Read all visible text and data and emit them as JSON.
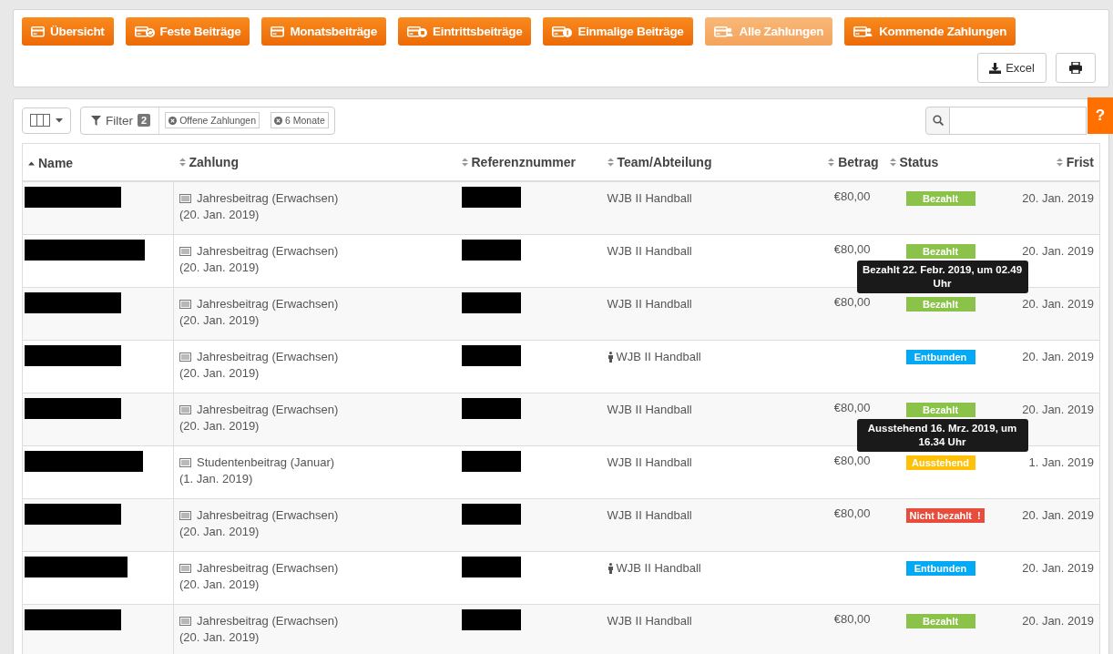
{
  "nav_tabs": [
    {
      "label": "Übersicht",
      "selected": false
    },
    {
      "label": "Feste Beiträge",
      "selected": false
    },
    {
      "label": "Monatsbeiträge",
      "selected": false
    },
    {
      "label": "Eintrittsbeiträge",
      "selected": false
    },
    {
      "label": "Einmalige Beiträge",
      "selected": false
    },
    {
      "label": "Alle Zahlungen",
      "selected": true
    },
    {
      "label": "Kommende Zahlungen",
      "selected": false
    }
  ],
  "export": {
    "excel_label": "Excel"
  },
  "help": {
    "label": "?"
  },
  "filter": {
    "label": "Filter",
    "count": "2",
    "chips": [
      "Offene Zahlungen",
      "6 Monate"
    ]
  },
  "table": {
    "columns": [
      {
        "label": "Name"
      },
      {
        "label": "Zahlung"
      },
      {
        "label": "Referenznummer"
      },
      {
        "label": "Team/Abteilung"
      },
      {
        "label": "Betrag"
      },
      {
        "label": "Status"
      },
      {
        "label": "Frist"
      }
    ],
    "rows": [
      {
        "payment": "Jahresbeitrag (Erwachsen)",
        "payment_date": "(20. Jan. 2019)",
        "team": "WJB II Handball",
        "team_person": false,
        "amount": "€80,00",
        "status": {
          "kind": "paid",
          "label": "Bezahlt"
        },
        "due": "20. Jan. 2019"
      },
      {
        "payment": "Jahresbeitrag (Erwachsen)",
        "payment_date": "(20. Jan. 2019)",
        "team": "WJB II Handball",
        "team_person": false,
        "amount": "€80,00",
        "status": {
          "kind": "paid",
          "label": "Bezahlt"
        },
        "due": "20. Jan. 2019"
      },
      {
        "payment": "Jahresbeitrag (Erwachsen)",
        "payment_date": "(20. Jan. 2019)",
        "team": "WJB II Handball",
        "team_person": false,
        "amount": "€80,00",
        "status": {
          "kind": "paid",
          "label": "Bezahlt",
          "tooltip": "Bezahlt 22. Febr. 2019, um 02.49 Uhr"
        },
        "due": "20. Jan. 2019"
      },
      {
        "payment": "Jahresbeitrag (Erwachsen)",
        "payment_date": "(20. Jan. 2019)",
        "team": "WJB II Handball",
        "team_person": true,
        "status": {
          "kind": "released",
          "label": "Entbunden"
        },
        "due": "20. Jan. 2019"
      },
      {
        "payment": "Jahresbeitrag (Erwachsen)",
        "payment_date": "(20. Jan. 2019)",
        "team": "WJB II Handball",
        "team_person": false,
        "amount": "€80,00",
        "status": {
          "kind": "paid",
          "label": "Bezahlt"
        },
        "due": "20. Jan. 2019"
      },
      {
        "payment": "Studentenbeitrag (Januar)",
        "payment_date": "(1. Jan. 2019)",
        "team": "WJB II Handball",
        "team_person": false,
        "amount": "€80,00",
        "status": {
          "kind": "pending",
          "label": "Ausstehend",
          "tooltip": "Ausstehend 16. Mrz. 2019, um 16.34 Uhr"
        },
        "due": "1. Jan. 2019"
      },
      {
        "payment": "Jahresbeitrag (Erwachsen)",
        "payment_date": "(20. Jan. 2019)",
        "team": "WJB II Handball",
        "team_person": false,
        "amount": "€80,00",
        "status": {
          "kind": "unpaid",
          "label": "Nicht bezahlt",
          "mark": "!"
        },
        "due": "20. Jan. 2019"
      },
      {
        "payment": "Jahresbeitrag (Erwachsen)",
        "payment_date": "(20. Jan. 2019)",
        "team": "WJB II Handball",
        "team_person": true,
        "status": {
          "kind": "released",
          "label": "Entbunden"
        },
        "due": "20. Jan. 2019"
      },
      {
        "payment": "Jahresbeitrag (Erwachsen)",
        "payment_date": "(20. Jan. 2019)",
        "team": "WJB II Handball",
        "team_person": false,
        "amount": "€80,00",
        "status": {
          "kind": "paid",
          "label": "Bezahlt"
        },
        "due": "20. Jan. 2019"
      }
    ]
  }
}
